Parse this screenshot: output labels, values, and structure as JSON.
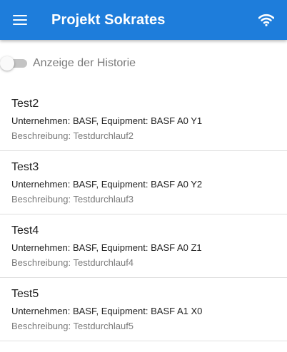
{
  "appbar": {
    "title": "Projekt Sokrates",
    "menu_icon": "menu-icon",
    "status_icon": "wifi-icon",
    "color": "#1e7ddb"
  },
  "history_toggle": {
    "label": "Anzeige der Historie",
    "checked": false
  },
  "items": [
    {
      "title": "Test2",
      "line1": "Unternehmen: BASF, Equipment: BASF A0 Y1",
      "line2": "Beschreibung: Testdurchlauf2"
    },
    {
      "title": "Test3",
      "line1": "Unternehmen: BASF, Equipment: BASF A0 Y2",
      "line2": "Beschreibung: Testdurchlauf3"
    },
    {
      "title": "Test4",
      "line1": "Unternehmen: BASF, Equipment: BASF A0 Z1",
      "line2": "Beschreibung: Testdurchlauf4"
    },
    {
      "title": "Test5",
      "line1": "Unternehmen: BASF, Equipment: BASF A1 X0",
      "line2": "Beschreibung: Testdurchlauf5"
    }
  ]
}
